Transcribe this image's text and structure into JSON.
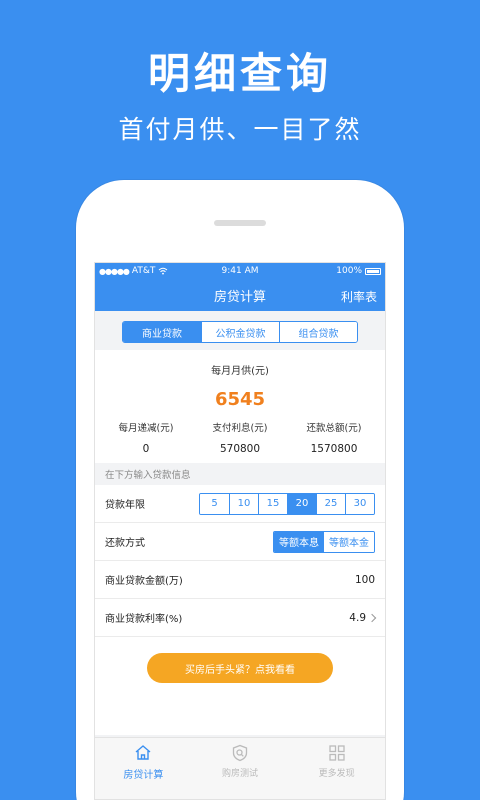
{
  "hero": {
    "title": "明细查询",
    "subtitle": "首付月供、一目了然"
  },
  "status_bar": {
    "carrier": "AT&T",
    "time": "9:41 AM",
    "battery": "100%"
  },
  "nav": {
    "title": "房贷计算",
    "right_link": "利率表"
  },
  "loan_tabs": [
    {
      "label": "商业贷款",
      "active": true
    },
    {
      "label": "公积金贷款",
      "active": false
    },
    {
      "label": "组合贷款",
      "active": false
    }
  ],
  "result": {
    "monthly_label": "每月月供(元)",
    "monthly_value": "6545",
    "stats": [
      {
        "label": "每月递减(元)",
        "value": "0"
      },
      {
        "label": "支付利息(元)",
        "value": "570800"
      },
      {
        "label": "还款总额(元)",
        "value": "1570800"
      }
    ]
  },
  "form": {
    "section_hint": "在下方输入贷款信息",
    "years_label": "贷款年限",
    "years": [
      {
        "label": "5",
        "active": false
      },
      {
        "label": "10",
        "active": false
      },
      {
        "label": "15",
        "active": false
      },
      {
        "label": "20",
        "active": true
      },
      {
        "label": "25",
        "active": false
      },
      {
        "label": "30",
        "active": false
      }
    ],
    "method_label": "还款方式",
    "methods": [
      {
        "label": "等额本息",
        "active": true
      },
      {
        "label": "等额本金",
        "active": false
      }
    ],
    "amount_label": "商业贷款金额(万)",
    "amount_value": "100",
    "rate_label": "商业贷款利率(%)",
    "rate_value": "4.9"
  },
  "cta": {
    "label": "买房后手头紧？点我看看"
  },
  "tabbar": [
    {
      "label": "房贷计算",
      "icon": "home-icon",
      "active": true
    },
    {
      "label": "购房测试",
      "icon": "shield-search-icon",
      "active": false
    },
    {
      "label": "更多发现",
      "icon": "grid-icon",
      "active": false
    }
  ],
  "colors": {
    "primary": "#3a8ff0",
    "accent": "#f0801e",
    "cta": "#f5a623"
  }
}
